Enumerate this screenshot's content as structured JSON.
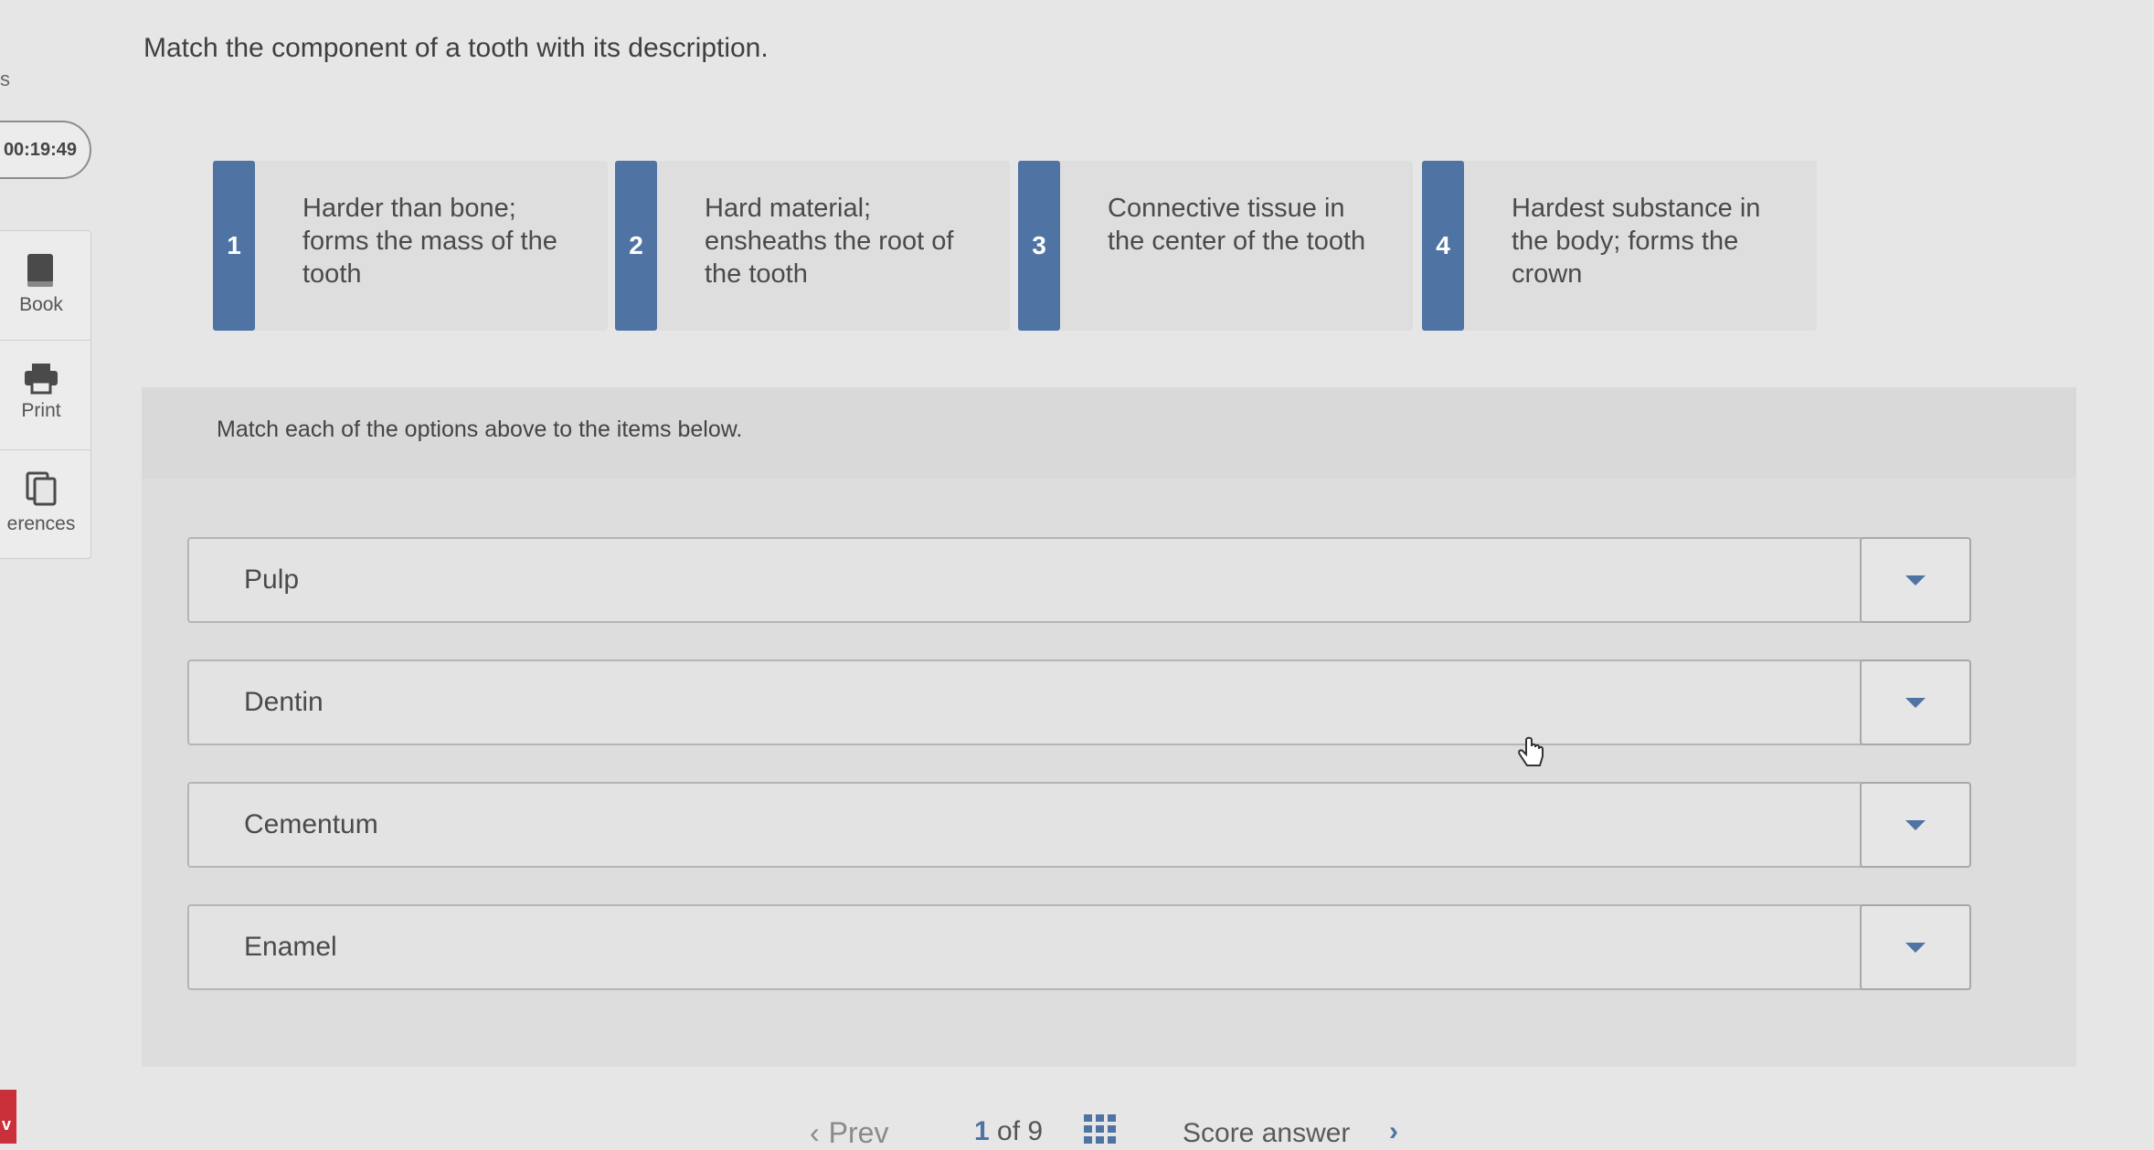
{
  "question": "Match the component of a tooth with its description.",
  "sidebar": {
    "partial_letter": "s",
    "timer": "00:19:49",
    "items": [
      {
        "label": "Book",
        "icon": "book-icon"
      },
      {
        "label": "Print",
        "icon": "printer-icon"
      },
      {
        "label": "erences",
        "icon": "references-icon"
      }
    ],
    "bottom_flag": "v"
  },
  "options": [
    {
      "number": "1",
      "text": "Harder than bone; forms the mass of the tooth"
    },
    {
      "number": "2",
      "text": "Hard material; ensheaths the root of the tooth"
    },
    {
      "number": "3",
      "text": "Connective tissue in the center of the tooth"
    },
    {
      "number": "4",
      "text": "Hardest substance in the body; forms the crown"
    }
  ],
  "instructions": "Match each of the options above to the items below.",
  "items": [
    {
      "label": "Pulp"
    },
    {
      "label": "Dentin"
    },
    {
      "label": "Cementum"
    },
    {
      "label": "Enamel"
    }
  ],
  "nav": {
    "prev": "Prev",
    "current": "1",
    "of": "of",
    "total": "9",
    "score": "Score answer"
  },
  "colors": {
    "accent": "#4f73a3",
    "background": "#e6e6e6"
  }
}
